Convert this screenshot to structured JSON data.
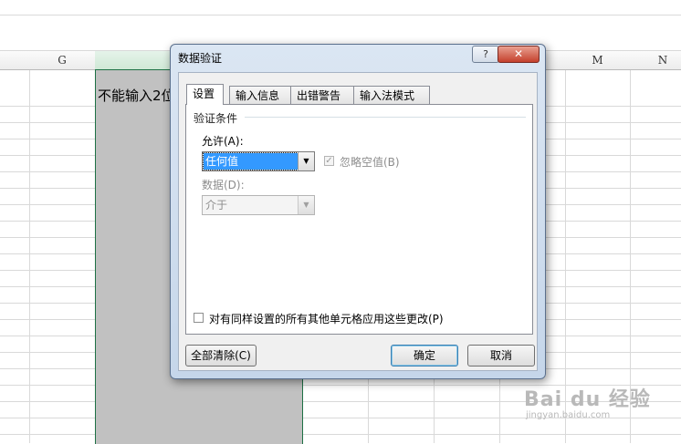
{
  "spreadsheet": {
    "columns": [
      "G",
      "M",
      "N"
    ],
    "cell_text": "不能输入2位"
  },
  "dialog": {
    "title": "数据验证",
    "help_label": "?",
    "close_label": "✕",
    "tabs": [
      {
        "label": "设置",
        "active": true
      },
      {
        "label": "输入信息",
        "active": false
      },
      {
        "label": "出错警告",
        "active": false
      },
      {
        "label": "输入法模式",
        "active": false
      }
    ],
    "group_label": "验证条件",
    "allow_label": "允许(A):",
    "allow_value": "任何值",
    "ignore_blank_label": "忽略空值(B)",
    "ignore_blank_checked": true,
    "data_label": "数据(D):",
    "data_value": "介于",
    "apply_all_label": "对有同样设置的所有其他单元格应用这些更改(P)",
    "apply_all_checked": false,
    "clear_all_label": "全部清除(C)",
    "ok_label": "确定",
    "cancel_label": "取消"
  },
  "watermark": {
    "main": "Bai du 经验",
    "sub": "jingyan.baidu.com"
  },
  "colors": {
    "selection": "#c1c1c1",
    "selection_border": "#1e7145",
    "highlight": "#3399ff",
    "close_button": "#c4402c"
  }
}
